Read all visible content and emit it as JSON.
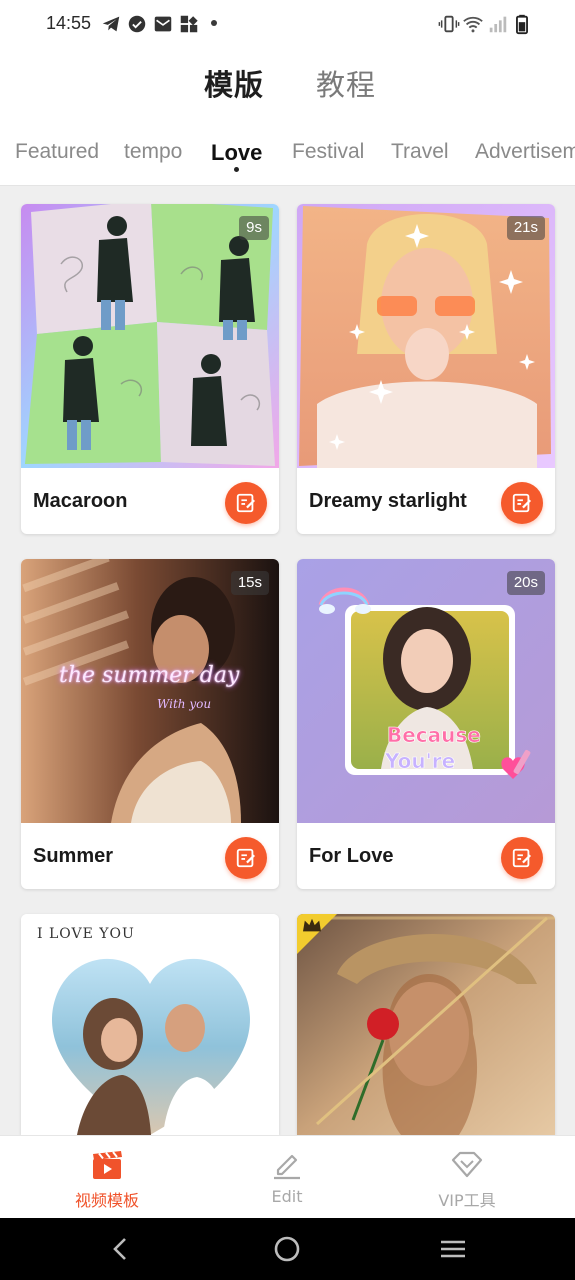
{
  "status_bar": {
    "time": "14:55",
    "left_icons": [
      "telegram-icon",
      "check-badge-icon",
      "mail-icon",
      "app-grid-icon"
    ],
    "right_icons": [
      "vibrate-icon",
      "wifi-icon",
      "signal-icon",
      "battery-icon"
    ]
  },
  "header": {
    "segments": [
      {
        "label": "模版",
        "active": true
      },
      {
        "label": "教程",
        "active": false
      }
    ],
    "tabs": [
      {
        "label": "Featured",
        "active": false
      },
      {
        "label": "tempo",
        "active": false
      },
      {
        "label": "Love",
        "active": true
      },
      {
        "label": "Festival",
        "active": false
      },
      {
        "label": "Travel",
        "active": false
      },
      {
        "label": "Advertisem",
        "active": false
      }
    ]
  },
  "templates": [
    {
      "title": "Macaroon",
      "duration": "9s"
    },
    {
      "title": "Dreamy starlight",
      "duration": "21s"
    },
    {
      "title": "Summer",
      "duration": "15s",
      "thumb_text": [
        "the summer day",
        "With you"
      ]
    },
    {
      "title": "For Love",
      "duration": "20s",
      "thumb_text": [
        "Because",
        "You're"
      ]
    },
    {
      "title": "",
      "duration": "",
      "thumb_text": [
        "I LOVE YOU"
      ]
    },
    {
      "title": "",
      "duration": "",
      "badge": "crown-icon"
    }
  ],
  "bottom_nav": [
    {
      "label": "视频模板",
      "icon": "video-template-icon",
      "active": true
    },
    {
      "label": "Edit",
      "icon": "edit-pencil-icon",
      "active": false
    },
    {
      "label": "VIP工具",
      "icon": "vip-diamond-icon",
      "active": false
    }
  ],
  "system_nav": [
    "back-icon",
    "home-icon",
    "recents-icon"
  ],
  "colors": {
    "accent": "#f55a2c",
    "background": "#efefef",
    "card": "#ffffff",
    "inactive_text": "#8a8a8a"
  }
}
